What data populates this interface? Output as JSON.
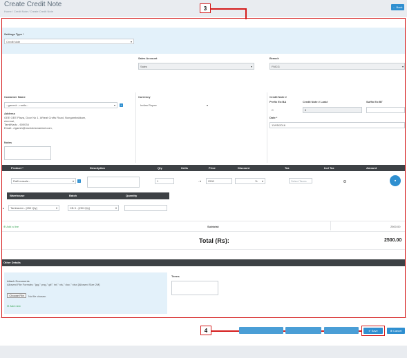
{
  "page": {
    "title": "Create Credit Note",
    "breadcrumb": [
      "Home",
      "Credit Note",
      "Create Credit Note"
    ],
    "back_label": "Back"
  },
  "callouts": {
    "form": "3",
    "actions": "4"
  },
  "settings": {
    "label": "Settings Type *",
    "value": "Credit Note"
  },
  "sales_account": {
    "label": "Sales Account",
    "value": "Sales"
  },
  "branch": {
    "label": "Branch",
    "value": "FMCG"
  },
  "customer": {
    "label": "Customer Name",
    "value": "--ganesh - naidu--",
    "address_label": "Address",
    "address_lines": [
      "GEE GEE Plaza, Door No 1, Wheat Crofts Road, Nungambakkam,",
      "chennai,",
      "TamilNadu - 600034",
      "Email: -rlgaesh@nscholesmartant.com,"
    ],
    "notes_label": "Notes"
  },
  "currency": {
    "label": "Currency",
    "value": "Indian Rupee"
  },
  "credit_note": {
    "label": "Credit Note #",
    "prefix_label": "Prefix Ex:BA",
    "number_label": "Credit Note # Last#",
    "suffix_label": "Suffix Ex:BT",
    "prefix_value": "C",
    "number_value": "8",
    "date_label": "Date *",
    "date_value": "13/05/2016"
  },
  "items_table": {
    "headers": [
      "Product *",
      "Description",
      "Qty",
      "Units",
      "Price",
      "Discount",
      "Tax",
      "Incl Tax",
      "Amount"
    ],
    "row": {
      "product": "Rafli masala -",
      "qty": "1",
      "units": "-",
      "price": "2500",
      "discount": "%",
      "tax_placeholder": "Select Taxes"
    }
  },
  "warehouse_table": {
    "headers": [
      "Warehouse",
      "Batch",
      "Quantity"
    ],
    "row": {
      "warehouse": "Tambaram - [250 Qty]",
      "batch": "CB 3 - [250 Qty]",
      "quantity": ""
    }
  },
  "add_line_label": "Add a line",
  "subtotal": {
    "label": "Subtotal:",
    "value": "2500.00"
  },
  "total": {
    "label": "Total (Rs):",
    "value": "2500.00"
  },
  "other_details": {
    "header": "Other Details",
    "attach_title": "Attach Documents",
    "attach_formats": "Allowed File Formats: \"jpg,\" png,\" gif,\" txt,\" xls,\" doc,\" xlsx [Allowed Size 2M]",
    "choose_file": "Choose File",
    "no_file": "No file chosen",
    "add_new": "Add new",
    "terms_label": "Terms"
  },
  "actions": {
    "save": "Save",
    "cancel": "Cancel"
  },
  "colors": {
    "accent": "#2f8fd0",
    "annotation": "#d41a1a",
    "band": "#e3f1fa",
    "dark_header": "#3d4145"
  }
}
